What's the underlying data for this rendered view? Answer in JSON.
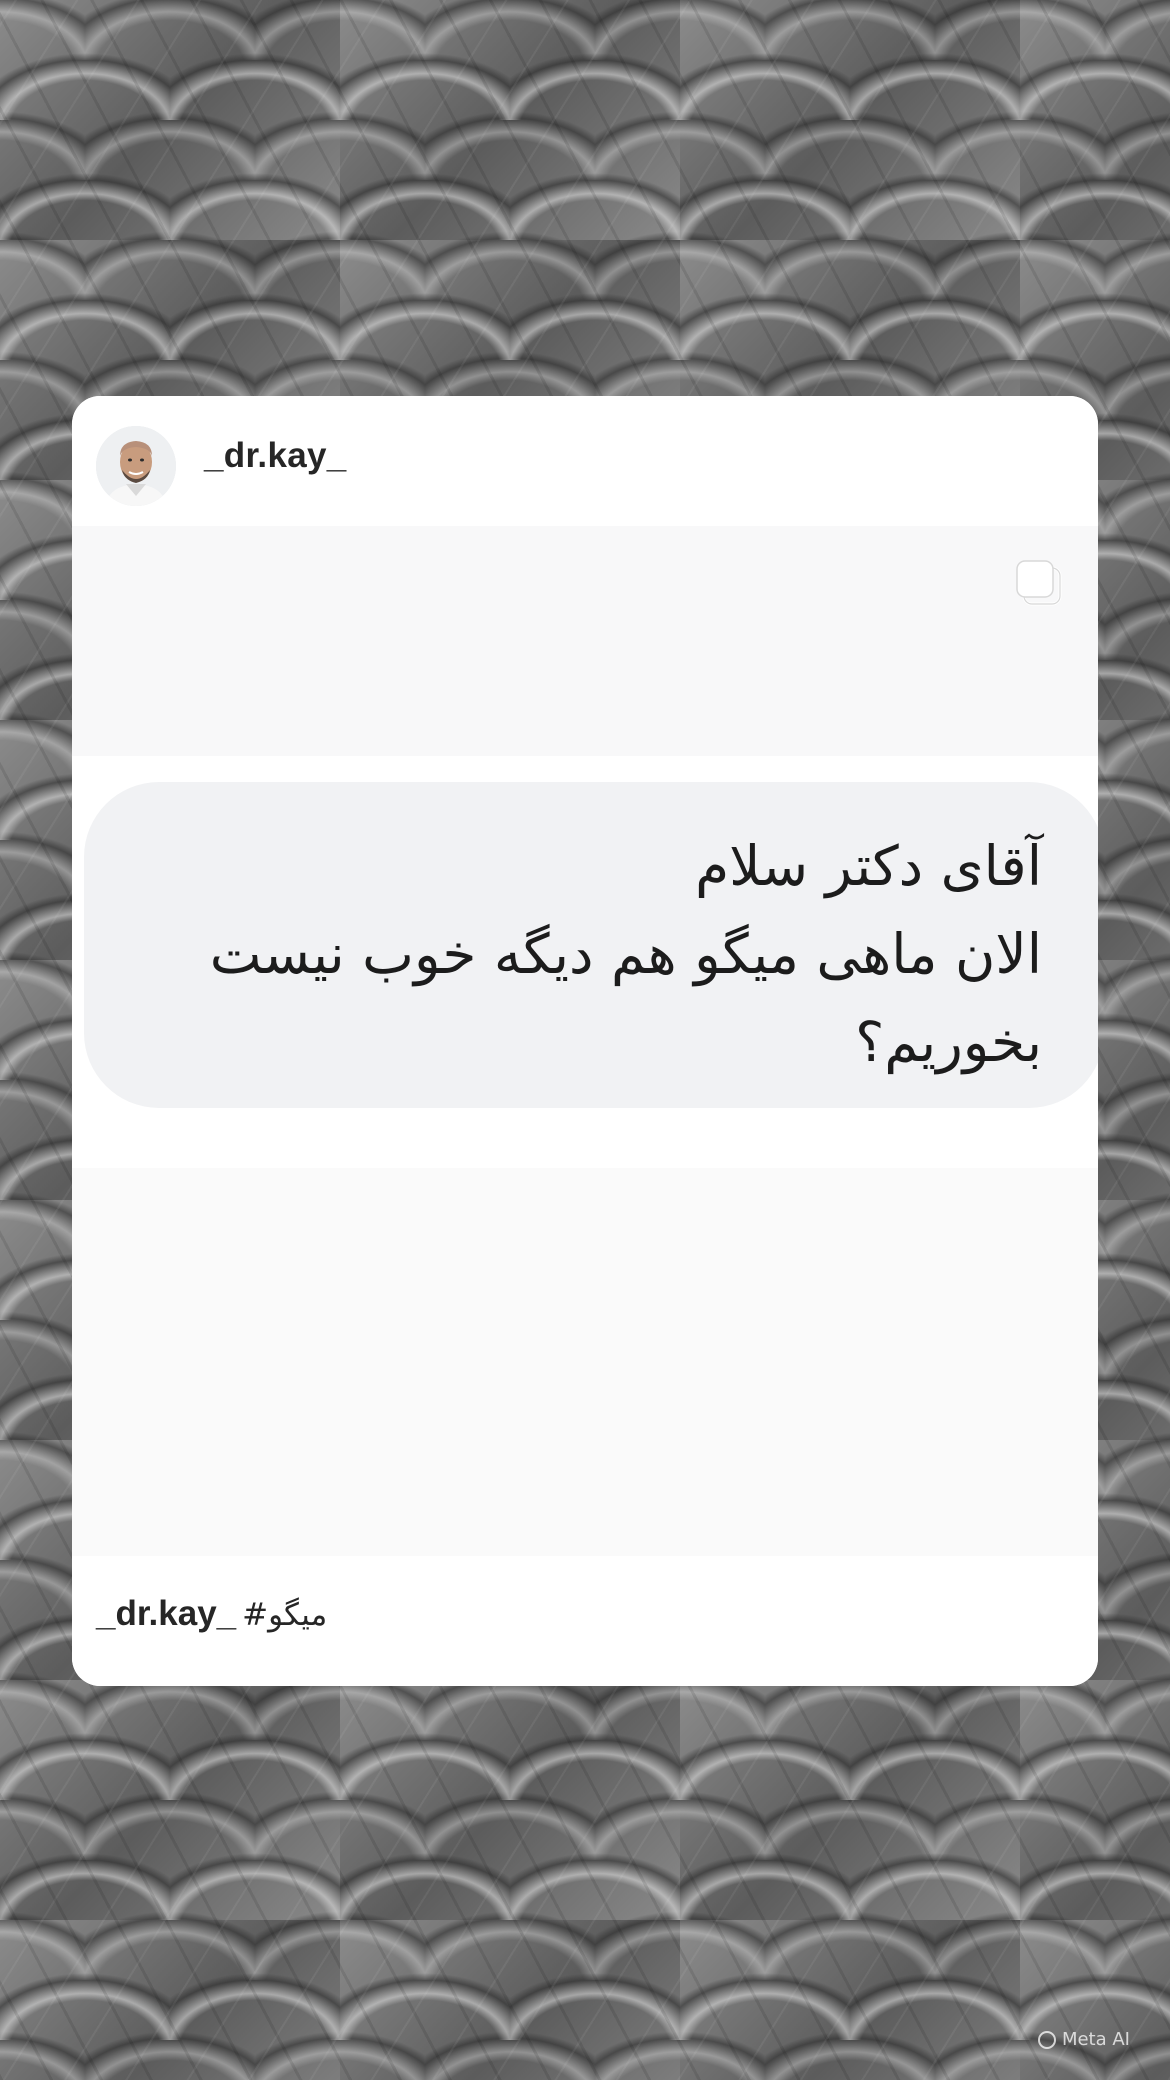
{
  "post": {
    "username": "_dr.kay_",
    "message_lines": [
      "آقای دکتر سلام",
      "الان ماهی میگو هم دیگه خوب نیست",
      "بخوریم؟"
    ],
    "caption_username": "_dr.kay_",
    "caption_hashtag": "#میگو",
    "avatar_icon": "profile-photo",
    "media_type_icon": "multiple-posts-icon"
  },
  "watermark": {
    "text": "Meta AI",
    "icon": "meta-ai-ring-icon"
  },
  "colors": {
    "card_background": "#ffffff",
    "bubble_background": "#f1f2f4",
    "text_primary": "#262626"
  }
}
